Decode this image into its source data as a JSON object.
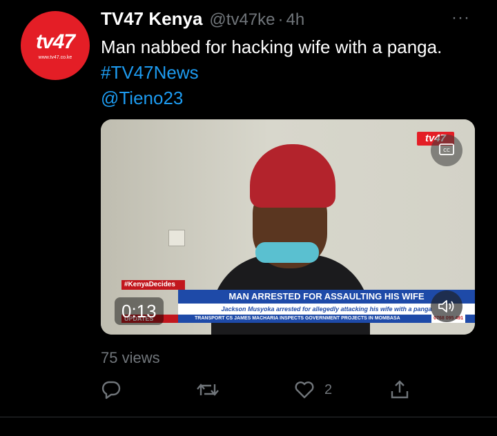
{
  "account": {
    "name": "TV47 Kenya",
    "handle": "@tv47ke",
    "separator": "·",
    "time": "4h",
    "avatar_logo": "tv47",
    "avatar_url": "www.tv47.co.ke"
  },
  "tweet": {
    "text": "Man nabbed for hacking wife with a panga.",
    "hashtag": "#TV47News",
    "mention": "@Tieno23"
  },
  "video": {
    "channel_logo": "tv47",
    "tag": "#KenyaDecides",
    "headline": "MAN ARRESTED FOR ASSAULTING HIS WIFE",
    "subheadline": "Jackson Musyoka arrested for allegedly attacking his wife with a panga",
    "updates_label": "UPDATES",
    "ticker": "TRANSPORT CS JAMES MACHARIA INSPECTS GOVERNMENT PROJECTS IN MOMBASA",
    "phone": "0768 095 491",
    "timer": "0:13"
  },
  "stats": {
    "views": "75 views",
    "likes": "2"
  },
  "menu": {
    "more": "···"
  },
  "colors": {
    "background": "#000000",
    "link": "#1d9bf0",
    "muted": "#71767b",
    "brand_red": "#e41e26",
    "chyron_blue": "#1e4aa8"
  }
}
